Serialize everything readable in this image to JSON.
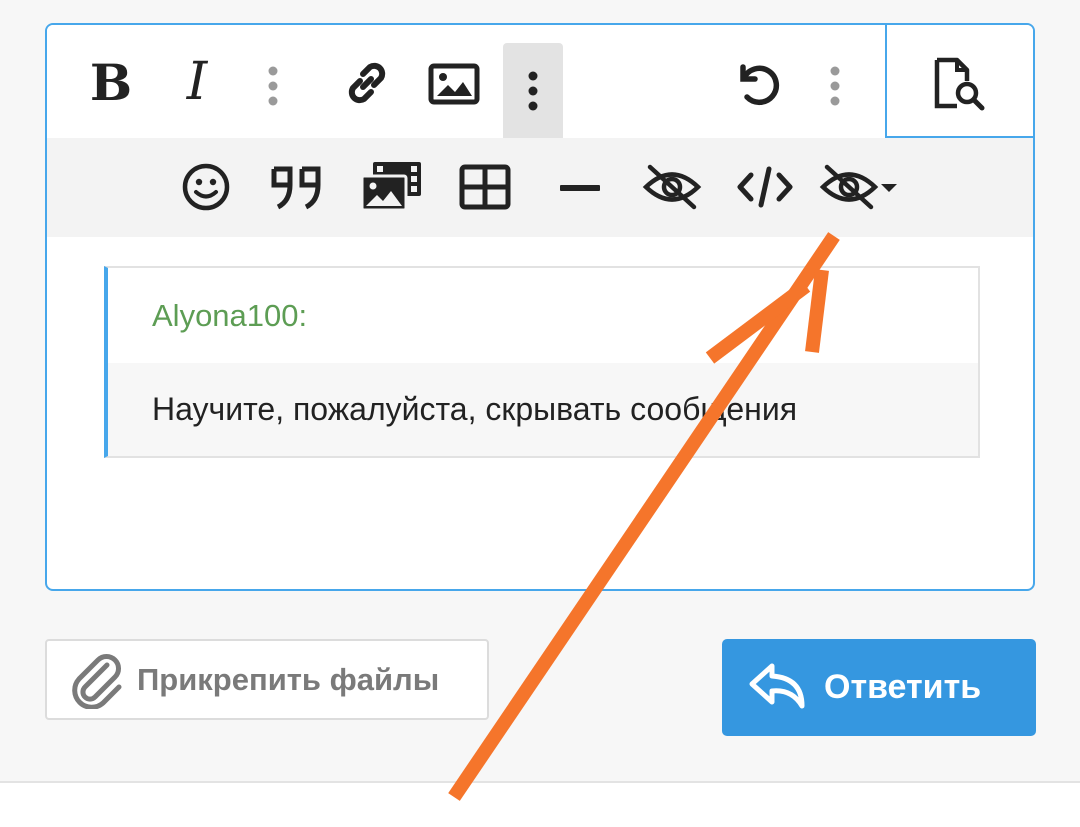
{
  "editor": {
    "toolbar_top": [
      {
        "name": "bold-button",
        "icon": "bold-icon",
        "label": "B"
      },
      {
        "name": "italic-button",
        "icon": "italic-icon",
        "label": "I"
      },
      {
        "name": "more-text-button",
        "icon": "vertical-dots-icon"
      },
      {
        "name": "link-button",
        "icon": "link-icon"
      },
      {
        "name": "image-button",
        "icon": "image-icon"
      },
      {
        "name": "more-insert-button",
        "icon": "vertical-dots-icon",
        "active": true
      },
      {
        "name": "undo-button",
        "icon": "undo-icon"
      },
      {
        "name": "more-options-button",
        "icon": "vertical-dots-icon"
      },
      {
        "name": "preview-button",
        "icon": "document-search-icon"
      }
    ],
    "toolbar_bottom": [
      {
        "name": "smilies-button",
        "icon": "smile-icon"
      },
      {
        "name": "quote-button",
        "icon": "quote-icon"
      },
      {
        "name": "media-button",
        "icon": "media-gallery-icon"
      },
      {
        "name": "table-button",
        "icon": "table-icon"
      },
      {
        "name": "horizontal-line-button",
        "icon": "horizontal-line-icon"
      },
      {
        "name": "spoiler-button",
        "icon": "eye-slash-icon"
      },
      {
        "name": "code-button",
        "icon": "code-icon"
      },
      {
        "name": "hide-dropdown-button",
        "icon": "eye-slash-dropdown-icon"
      }
    ],
    "quote": {
      "author": "Alyona100:",
      "text": "Научите, пожалуйста, скрывать сообщения"
    }
  },
  "actions": {
    "attach_label": "Прикрепить файлы",
    "reply_label": "Ответить"
  },
  "colors": {
    "accent": "#47a7eb",
    "reply_button": "#3597e0",
    "author_green": "#5d9d54",
    "annotation_arrow": "#f5752b"
  }
}
